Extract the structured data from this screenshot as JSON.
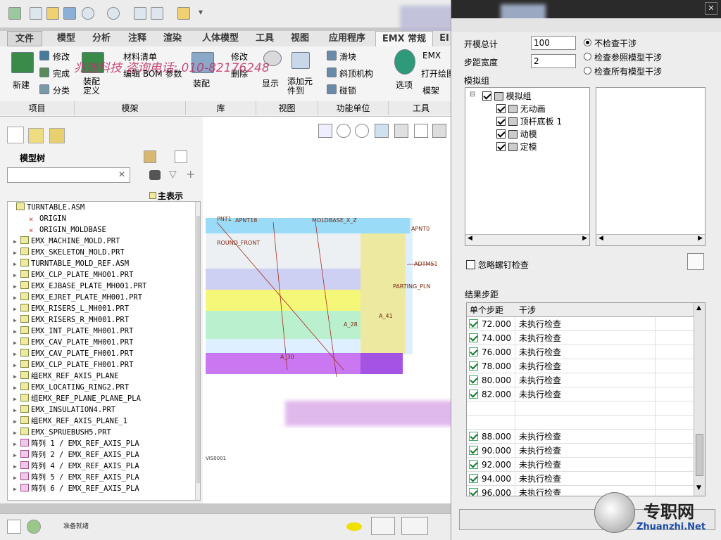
{
  "tabs": [
    "文件",
    "模型",
    "分析",
    "注释",
    "渲染",
    "人体模型",
    "工具",
    "视图",
    "应用程序",
    "EMX 常规",
    "EI"
  ],
  "ribbon": {
    "buttons": [
      "修改",
      "新建",
      "完成",
      "分类",
      "材料清单",
      "编辑 BOM 参数",
      "装配定义",
      "修改",
      "删除",
      "装配",
      "显示",
      "添加元件到",
      "滑块",
      "斜顶机构",
      "碰锁",
      "选项",
      "EMX",
      "打开绘图",
      "模架"
    ],
    "groups": [
      "项目",
      "模架",
      "库",
      "视图",
      "功能单位",
      "工具"
    ]
  },
  "watermark": "兆迪科技 咨询电话: 010-82176248",
  "left_panel": {
    "title": "模型树",
    "display_label": "主表示",
    "tree": [
      "TURNTABLE.ASM",
      "ORIGIN",
      "ORIGIN_MOLDBASE",
      "EMX_MACHINE_MOLD.PRT",
      "EMX_SKELETON_MOLD.PRT",
      "TURNTABLE_MOLD_REF.ASM",
      "EMX_CLP_PLATE_MHO01.PRT",
      "EMX_EJBASE_PLATE_MH001.PRT",
      "EMX_EJRET_PLATE_MH001.PRT",
      "EMX_RISERS_L_MH001.PRT",
      "EMX_RISERS_R_MH001.PRT",
      "EMX_INT_PLATE_MH001.PRT",
      "EMX_CAV_PLATE_MH001.PRT",
      "EMX_CAV_PLATE_FH001.PRT",
      "EMX_CLP_PLATE_FH001.PRT",
      "组EMX_REF_AXIS_PLANE",
      "EMX_LOCATING_RING2.PRT",
      "组EMX_REF_PLANE_PLANE_PLA",
      "EMX_INSULATION4.PRT",
      "组EMX_REF_AXIS_PLANE_1",
      "EMX_SPRUEBUSH5.PRT",
      "阵列 1 / EMX_REF_AXIS_PLA",
      "阵列 2 / EMX_REF_AXIS_PLA",
      "阵列 4 / EMX_REF_AXIS_PLA",
      "阵列 5 / EMX_REF_AXIS_PLA",
      "阵列 6 / EMX_REF_AXIS_PLA"
    ]
  },
  "graphics": {
    "labels": [
      "PNT1",
      "APNT18",
      "MOLDBASE_X_Z",
      "APNT0",
      "ADTM51",
      "PARTING_PLN",
      "ROUND_FRONT",
      "A_28",
      "A_30",
      "A_41"
    ],
    "view_label": "VIS0001"
  },
  "dialog": {
    "open_total_label": "开模总计",
    "open_total_value": "100",
    "step_width_label": "步距宽度",
    "step_width_value": "2",
    "radio_options": [
      "不检查干涉",
      "检查参照模型干涉",
      "检查所有模型干涉"
    ],
    "radio_selected": 0,
    "sim_group_label": "模拟组",
    "sim_tree": [
      "模拟组",
      "无动画",
      "顶杆底板 1",
      "动模",
      "定模"
    ],
    "ignore_screw_label": "忽略螺钉检查",
    "results_label": "结果步距",
    "col_step": "单个步距",
    "col_interference": "干涉",
    "rows": [
      {
        "step": "72.000",
        "status": "未执行检查"
      },
      {
        "step": "74.000",
        "status": "未执行检查"
      },
      {
        "step": "76.000",
        "status": "未执行检查"
      },
      {
        "step": "78.000",
        "status": "未执行检查"
      },
      {
        "step": "80.000",
        "status": "未执行检查"
      },
      {
        "step": "82.000",
        "status": "未执行检查"
      },
      {
        "step": "",
        "status": ""
      },
      {
        "step": "",
        "status": ""
      },
      {
        "step": "88.000",
        "status": "未执行检查"
      },
      {
        "step": "90.000",
        "status": "未执行检查"
      },
      {
        "step": "92.000",
        "status": "未执行检查"
      },
      {
        "step": "94.000",
        "status": "未执行检查"
      },
      {
        "step": "96.000",
        "status": "未执行检查"
      }
    ]
  },
  "status_bar": {
    "message": "准备就绪"
  },
  "logo": {
    "cn": "专职网",
    "en": "Zhuanzhi.Net"
  }
}
